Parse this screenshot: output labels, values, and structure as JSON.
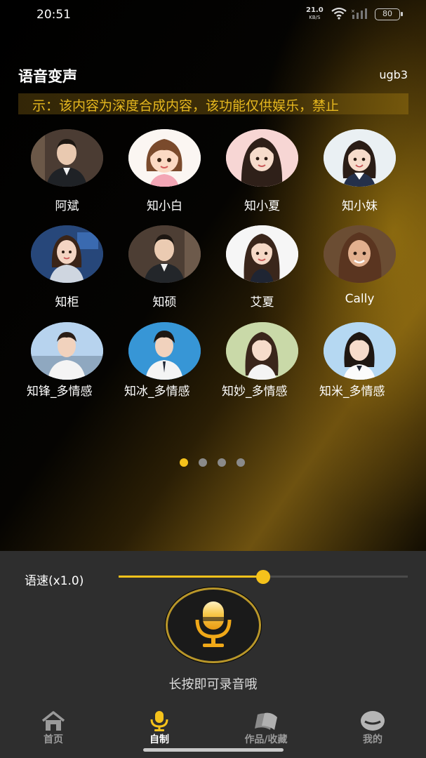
{
  "status_bar": {
    "time": "20:51",
    "speed": "21.0",
    "speed_unit": "KB/S",
    "battery": "80"
  },
  "header": {
    "title": "语音变声",
    "code": "ugb3"
  },
  "notice": "示：该内容为深度合成内容，该功能仅供娱乐，禁止",
  "voices": [
    {
      "name": "阿斌"
    },
    {
      "name": "知小白"
    },
    {
      "name": "知小夏"
    },
    {
      "name": "知小妹"
    },
    {
      "name": "知柜"
    },
    {
      "name": "知硕"
    },
    {
      "name": "艾夏"
    },
    {
      "name": "Cally"
    },
    {
      "name": "知锋_多情感"
    },
    {
      "name": "知冰_多情感"
    },
    {
      "name": "知妙_多情感"
    },
    {
      "name": "知米_多情感"
    }
  ],
  "pager": {
    "pages": 4,
    "active": 0
  },
  "speed": {
    "label": "语速(x1.0)",
    "value": 1.0,
    "fill_fraction": 0.5
  },
  "record": {
    "hint": "长按即可录音哦"
  },
  "tabs": [
    {
      "label": "首页",
      "icon": "home-icon"
    },
    {
      "label": "自制",
      "icon": "mic-icon",
      "active": true
    },
    {
      "label": "作品/收藏",
      "icon": "works-icon"
    },
    {
      "label": "我的",
      "icon": "profile-icon"
    }
  ],
  "colors": {
    "accent": "#f5c21b",
    "panel": "#2e2e2e"
  }
}
